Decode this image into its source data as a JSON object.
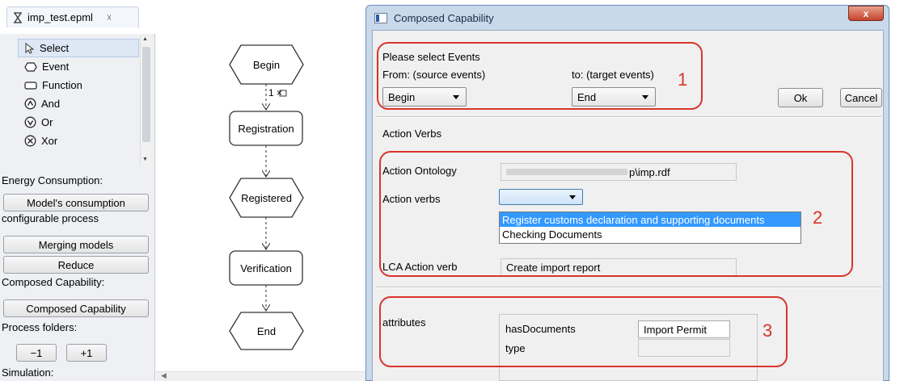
{
  "editor": {
    "tab_title": "imp_test.epml",
    "tab_close": "☓",
    "palette": {
      "tools": [
        {
          "label": "Select",
          "icon": "cursor-icon"
        },
        {
          "label": "Event",
          "icon": "event-hexagon-icon"
        },
        {
          "label": "Function",
          "icon": "function-rect-icon"
        },
        {
          "label": "And",
          "icon": "and-connector-icon"
        },
        {
          "label": "Or",
          "icon": "or-connector-icon"
        },
        {
          "label": "Xor",
          "icon": "xor-connector-icon"
        }
      ],
      "energy_label": "Energy Consumption:",
      "model_consumption_button": "Model's consumption",
      "configurable_label": "configurable process",
      "merging_button": "Merging models",
      "reduce_button": "Reduce",
      "composed_label": "Composed Capability:",
      "composed_button": "Composed Capability",
      "folders_label": "Process folders:",
      "minus_button": "−1",
      "plus_button": "+1",
      "simulation_label": "Simulation:"
    },
    "diagram": {
      "nodes": [
        {
          "label": "Begin",
          "kind": "event"
        },
        {
          "label": "Registration",
          "kind": "function"
        },
        {
          "label": "Registered",
          "kind": "event"
        },
        {
          "label": "Verification",
          "kind": "function"
        },
        {
          "label": "End",
          "kind": "event"
        }
      ],
      "connector_label": "1 ×"
    }
  },
  "dialog": {
    "title": "Composed Capability",
    "close_label": "x",
    "select_events_label": "Please select Events",
    "from_label": "From: (source events)",
    "to_label": "to: (target events)",
    "from_value": "Begin",
    "to_value": "End",
    "ok_label": "Ok",
    "cancel_label": "Cancel",
    "action_verbs_header": "Action Verbs",
    "ontology_label": "Action Ontology",
    "ontology_value": "p\\imp.rdf",
    "action_verbs_label": "Action verbs",
    "dropdown_options": [
      "Register customs declaration and supporting documents",
      "Checking Documents"
    ],
    "lca_label": "LCA Action verb",
    "lca_value": "Create import report",
    "attributes_label": "attributes",
    "attr_rows": [
      {
        "name": "hasDocuments",
        "value": "Import Permit"
      },
      {
        "name": "type",
        "value": ""
      }
    ],
    "callouts": [
      "1",
      "2",
      "3"
    ]
  },
  "colors": {
    "callout_red": "#d9342b",
    "dropdown_highlight": "#3399ff",
    "dialog_frame": "#c9d9ec"
  }
}
